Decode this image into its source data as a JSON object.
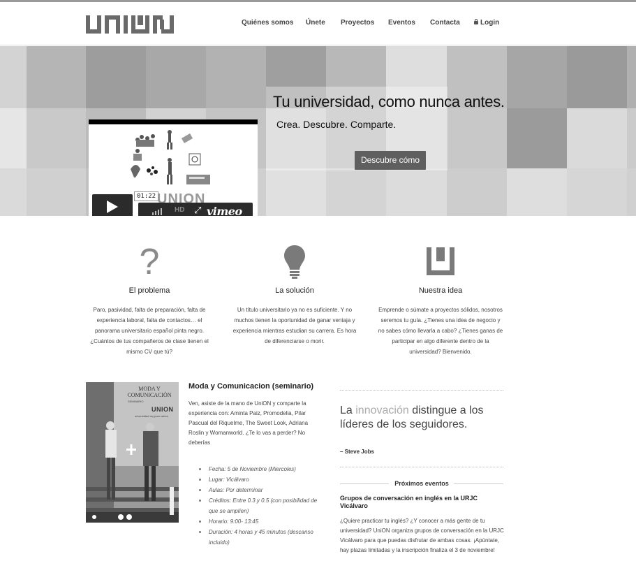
{
  "header": {
    "logo_text": "UNION",
    "nav": [
      {
        "label": "Quiénes somos"
      },
      {
        "label": "Únete"
      },
      {
        "label": "Proyectos"
      },
      {
        "label": "Eventos"
      },
      {
        "label": "Contacta"
      },
      {
        "label": "Login",
        "icon": "lock-icon"
      }
    ]
  },
  "hero": {
    "video": {
      "time": "01:22",
      "brand": "vimeo",
      "watermark": "UNION",
      "play_icon": "play-icon",
      "volume_icon": "volume-icon",
      "hd_label": "HD",
      "fullscreen_icon": "fullscreen-icon"
    },
    "title": "Tu universidad, como nunca antes.",
    "subtitle": "Crea. Descubre. Comparte.",
    "button": "Descubre cómo"
  },
  "features": [
    {
      "icon": "question-icon",
      "title": "El problema",
      "text": "Paro, pasividad, falta de preparación, falta de experiencia laboral, falta de contactos… el panorama universitario español pinta negro. ¿Cuántos de tus compañeros de clase tienen el mismo CV que tú?"
    },
    {
      "icon": "lightbulb-icon",
      "title": "La solución",
      "text": "Un título universitario ya no es suficiente. Y no muchos tienen la oportunidad de ganar ventaja y experiencia mientras estudian su carrera. Es hora de diferenciarse o morir."
    },
    {
      "icon": "union-logo-icon",
      "title": "Nuestra idea",
      "text": "Emprende o súmate a proyectos sólidos, nosotros seremos tu guía. ¿Tienes una idea de negocio y no sabes cómo llevarla a cabo? ¿Tienes ganas de participar en algo diferente dentro de la universidad? Bienvenido."
    }
  ],
  "article": {
    "poster": {
      "title": "MODA Y COMUNICACIÓN",
      "subtitle": "SEMINARIO",
      "brand": "UNION",
      "small": "universidad rey juan carlos"
    },
    "title": "Moda y Comunicacion (seminario)",
    "body": "Ven, asiste de la mano de UniON y comparte la experiencia con: Aminta Paiz, Promodelia, Pilar Pascual del Riquelme, The Sweet Look, Adriana Roslin y Womanworld. ¿Te lo vas a perder? No deberías",
    "details": [
      "Fecha: 5 de Noviembre (Miercoles)",
      "Lugar: Vicálvaro",
      "Aulas: Por determinar",
      "Créditos: Entre 0.3 y 0.5 (con posibilidad de que se amplíen)",
      "Horario: 9:00- 13:45",
      "Duración: 4 horas y 45 minutos (descanso incluido)"
    ]
  },
  "quote": {
    "before": "La ",
    "highlight": "innovación",
    "after": " distingue a los líderes de los seguidores.",
    "author": "– Steve Jobs"
  },
  "events": {
    "heading": "Próximos eventos",
    "title": "Grupos de conversación en inglés en la URJC Vicálvaro",
    "body": "¿Quiere practicar tu inglés? ¿Y conocer a más gente de tu universidad? UniON organiza grupos de conversación en la URJC Vicálvaro para que puedas disfrutar de ambas cosas. ¡Apúntate, hay plazas limitadas y la inscripción finaliza el 3 de noviembre!"
  }
}
